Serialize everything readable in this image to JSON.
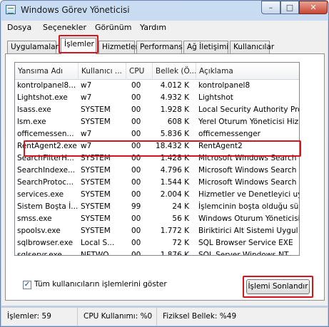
{
  "window": {
    "title": "Windows Görev Yöneticisi",
    "controls": {
      "minimize": "–",
      "maximize": "□",
      "close": "✕"
    }
  },
  "menu": [
    "Dosya",
    "Seçenekler",
    "Görünüm",
    "Yardım"
  ],
  "tabs": [
    "Uygulamalar",
    "İşlemler",
    "Hizmetler",
    "Performans",
    "Ağ İletişimi",
    "Kullanıcılar"
  ],
  "active_tab": "İşlemler",
  "table": {
    "columns": [
      "Yansıma Adı",
      "Kullanıcı ...",
      "CPU",
      "Bellek (Ö...",
      "Açıklama"
    ],
    "rows": [
      [
        "kontrolpanel8...",
        "w7",
        "00",
        "4.012 K",
        "kontrolpanel8"
      ],
      [
        "Lightshot.exe",
        "w7",
        "00",
        "4.932 K",
        "Lightshot"
      ],
      [
        "lsass.exe",
        "SYSTEM",
        "00",
        "1.928 K",
        "Local Security Authority Pro"
      ],
      [
        "lsm.exe",
        "SYSTEM",
        "00",
        "608 K",
        "Yerel Oturum Yöneticisi Hizm"
      ],
      [
        "officemessen...",
        "w7",
        "00",
        "5.836 K",
        "officemessenger"
      ],
      [
        "RentAgent2.exe",
        "w7",
        "00",
        "18.432 K",
        "RentAgent2"
      ],
      [
        "SearchFilterH...",
        "SYSTEM",
        "00",
        "1.428 K",
        "Microsoft Windows Search F"
      ],
      [
        "SearchIndexe...",
        "SYSTEM",
        "00",
        "4.796 K",
        "Microsoft Windows Search İ"
      ],
      [
        "SearchProtoc...",
        "SYSTEM",
        "00",
        "1.544 K",
        "Microsoft Windows Search P"
      ],
      [
        "services.exe",
        "SYSTEM",
        "00",
        "2.004 K",
        "Hizmetler ve Denetleyici uy"
      ],
      [
        "Sistem Boşta İ...",
        "SYSTEM",
        "99",
        "24 K",
        "İşlemcinin boşta olduğu sür"
      ],
      [
        "smss.exe",
        "SYSTEM",
        "00",
        "56 K",
        "Windows Oturum Yöneticisi"
      ],
      [
        "spoolsv.exe",
        "SYSTEM",
        "00",
        "1.772 K",
        "Biriktirici Alt Sistemi Uygul"
      ],
      [
        "sqlbrowser.exe",
        "Local S...",
        "00",
        "72 K",
        "SQL Browser Service EXE"
      ],
      [
        "sqlservr.exe",
        "NETWO...",
        "00",
        "1.876 K",
        "SQL Server Windows NT"
      ]
    ],
    "highlighted_row": "RentAgent2.exe"
  },
  "show_all_users": {
    "label": "Tüm kullanıcıların işlemlerini göster",
    "checked": true,
    "mark": "✓"
  },
  "end_process_button": "İşlemi Sonlandır",
  "scrollbar": {
    "up": "▲",
    "down": "▼"
  },
  "status": {
    "processes": "İşlemler: 59",
    "cpu": "CPU Kullanımı: %0",
    "memory": "Fiziksel Bellek: %49"
  },
  "colors": {
    "highlight_box": "#d4141e",
    "window_frame": "#b7cde9"
  }
}
